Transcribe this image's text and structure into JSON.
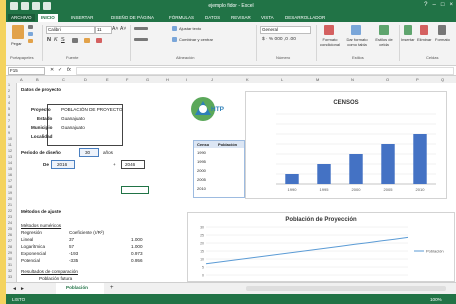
{
  "window": {
    "title": "ejemplo fidor - Excel"
  },
  "ribbon_tabs": [
    "ARCHIVO",
    "INICIO",
    "INSERTAR",
    "DISEÑO DE PÁGINA",
    "FÓRMULAS",
    "DATOS",
    "REVISAR",
    "VISTA",
    "DESARROLLADOR"
  ],
  "ribbon": {
    "paste_label": "Pegar",
    "font_name": "Calibri",
    "font_size": "11",
    "wrap_label": "Ajustar texto",
    "merge_label": "Combinar y centrar",
    "number_format": "General",
    "cond_format_label": "Formato condicional",
    "table_format_label": "Dar formato como tabla",
    "cell_styles_label": "Estilos de celda",
    "insert_label": "Insertar",
    "delete_label": "Eliminar",
    "format_label": "Formato",
    "groups": [
      "Portapapeles",
      "Fuente",
      "Alineación",
      "Número",
      "Estilos",
      "Celdas"
    ]
  },
  "formula_bar": {
    "name_box": "F15",
    "fx": "fx",
    "value": ""
  },
  "columns": [
    "A",
    "B",
    "C",
    "D",
    "E",
    "F",
    "G",
    "H",
    "I",
    "J",
    "K",
    "L",
    "M",
    "N",
    "O",
    "P",
    "Q"
  ],
  "rows": [
    "1",
    "2",
    "3",
    "4",
    "5",
    "6",
    "7",
    "8",
    "9",
    "10",
    "11",
    "12",
    "13",
    "14",
    "15",
    "16",
    "17",
    "18",
    "19",
    "20",
    "21",
    "22",
    "23",
    "24",
    "25",
    "26",
    "27",
    "28",
    "29",
    "30",
    "31",
    "32",
    "33"
  ],
  "project": {
    "heading": "Datos de proyecto",
    "labels": [
      "Proyecto",
      "Estado",
      "Municipio",
      "Localidad"
    ],
    "values": [
      "POBLACIÓN DE PROYECTO",
      "Guanajuato",
      "Guanajuato",
      ""
    ],
    "period_label": "Periodo de diseño",
    "period_value": "30",
    "period_unit": "años",
    "year_label": "De",
    "year_from": "2016",
    "year_plus": "+",
    "year_to": "2046"
  },
  "logo": {
    "text": "HTP"
  },
  "census": {
    "header": [
      "Censo",
      "Población"
    ],
    "rows": [
      [
        "1990",
        ""
      ],
      [
        "1995",
        ""
      ],
      [
        "2000",
        ""
      ],
      [
        "2005",
        ""
      ],
      [
        "2010",
        ""
      ]
    ]
  },
  "methods": {
    "heading": "Métodos de ajuste",
    "subheading": "Métodos numéricos",
    "col_headers": [
      "Regresión",
      "Coeficiente (r/R²)",
      ""
    ],
    "rows": [
      {
        "name": "Lineal",
        "r": "37",
        "v": "1.000"
      },
      {
        "name": "Logarítmica",
        "r": "57",
        "v": "1.000"
      },
      {
        "name": "Exponencial",
        "r": "-193",
        "v": "0.973"
      },
      {
        "name": "Potencial",
        "r": "-335",
        "v": "0.956"
      }
    ],
    "footnote": "Resultados de comparación",
    "footnote2": "Población futura"
  },
  "sheet_tabs": {
    "active": "Población",
    "add": "+"
  },
  "status": {
    "left": "LISTO",
    "zoom": "100%"
  },
  "chart_data": [
    {
      "type": "bar",
      "title": "CENSOS",
      "categories": [
        "1990",
        "1995",
        "2000",
        "2005",
        "2010"
      ],
      "values": [
        1.0,
        2.0,
        3.0,
        4.0,
        5.0
      ],
      "ylim": [
        0,
        7
      ],
      "color": "#4472c4",
      "grid": true
    },
    {
      "type": "line",
      "title": "Población de Proyección",
      "x": [
        0,
        1,
        2,
        3,
        4,
        5,
        6,
        7,
        8,
        9,
        10,
        11,
        12,
        13,
        14,
        15
      ],
      "series": [
        {
          "name": "Población",
          "values": [
            7,
            8.1,
            9.2,
            10.3,
            11.4,
            12.5,
            13.6,
            14.7,
            15.8,
            16.9,
            18.0,
            19.1,
            20.2,
            21.3,
            22.4,
            23.5
          ]
        }
      ],
      "ylim": [
        0,
        30
      ],
      "yticks": [
        "30",
        "25",
        "20",
        "15",
        "10",
        "5",
        "0"
      ],
      "color": "#5b9bd5",
      "legend": "right",
      "grid": true
    }
  ]
}
